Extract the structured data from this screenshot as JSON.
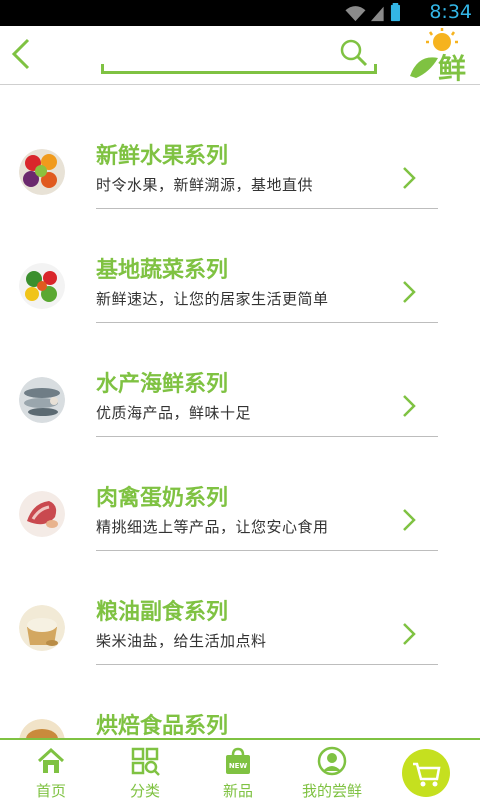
{
  "status": {
    "time": "8:34"
  },
  "search": {
    "placeholder": ""
  },
  "categories": [
    {
      "title": "新鲜水果系列",
      "subtitle": "时令水果，新鲜溯源，基地直供",
      "thumb": "fruit-thumbnail"
    },
    {
      "title": "基地蔬菜系列",
      "subtitle": "新鲜速达，让您的居家生活更简单",
      "thumb": "vegetable-thumbnail"
    },
    {
      "title": "水产海鲜系列",
      "subtitle": "优质海产品，鲜味十足",
      "thumb": "seafood-thumbnail"
    },
    {
      "title": "肉禽蛋奶系列",
      "subtitle": "精挑细选上等产品，让您安心食用",
      "thumb": "meat-thumbnail"
    },
    {
      "title": "粮油副食系列",
      "subtitle": "柴米油盐，给生活加点料",
      "thumb": "grain-thumbnail"
    },
    {
      "title": "烘焙食品系列",
      "subtitle": "",
      "thumb": "bakery-thumbnail"
    }
  ],
  "tabs": [
    {
      "label": "首页",
      "icon": "home-icon"
    },
    {
      "label": "分类",
      "icon": "category-icon"
    },
    {
      "label": "新品",
      "icon": "new-bag-icon",
      "badge": "NEW"
    },
    {
      "label": "我的尝鲜",
      "icon": "user-icon"
    }
  ],
  "logo": {
    "text": "鲜"
  },
  "colors": {
    "accent": "#7fc242",
    "cart": "#c5e01f",
    "status_time": "#33b5e5"
  }
}
